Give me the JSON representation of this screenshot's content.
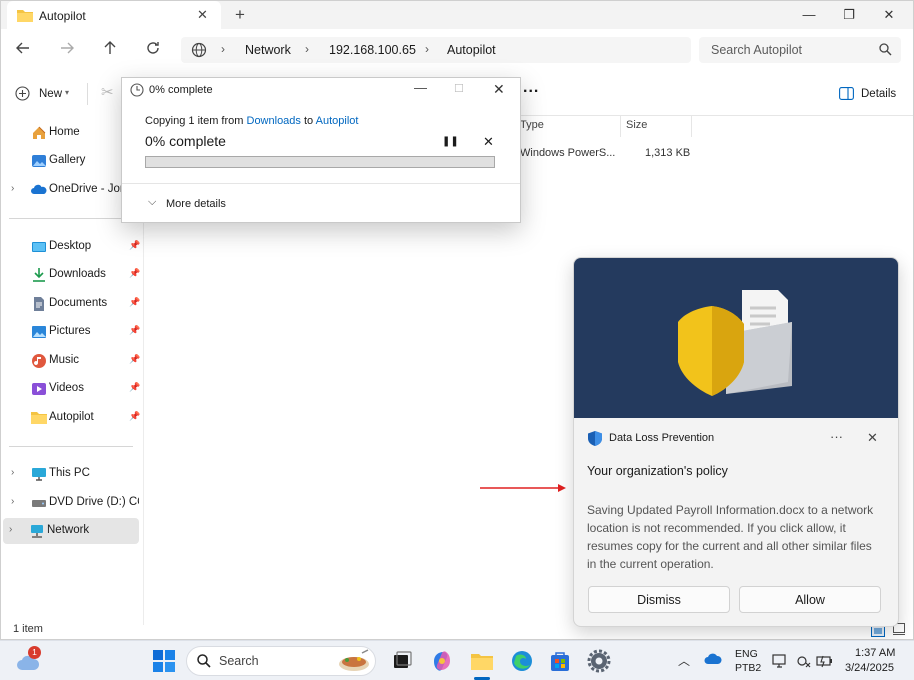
{
  "tab": {
    "title": "Autopilot"
  },
  "breadcrumb": [
    "Network",
    "192.168.100.65",
    "Autopilot"
  ],
  "search": {
    "placeholder": "Search Autopilot"
  },
  "toolbar": {
    "new_label": "New",
    "more": "...",
    "details_label": "Details"
  },
  "sidebar": {
    "top": [
      {
        "label": "Home",
        "icon": "home-icon"
      },
      {
        "label": "Gallery",
        "icon": "gallery-icon"
      },
      {
        "label": "OneDrive - Jorn",
        "icon": "onedrive-icon"
      }
    ],
    "quick": [
      {
        "label": "Desktop",
        "icon": "desktop-icon"
      },
      {
        "label": "Downloads",
        "icon": "downloads-icon"
      },
      {
        "label": "Documents",
        "icon": "documents-icon"
      },
      {
        "label": "Pictures",
        "icon": "pictures-icon"
      },
      {
        "label": "Music",
        "icon": "music-icon"
      },
      {
        "label": "Videos",
        "icon": "videos-icon"
      },
      {
        "label": "Autopilot",
        "icon": "folder-icon"
      }
    ],
    "bottom": [
      {
        "label": "This PC",
        "icon": "pc-icon"
      },
      {
        "label": "DVD Drive (D:) CCC",
        "icon": "dvd-icon"
      },
      {
        "label": "Network",
        "icon": "network-icon"
      }
    ]
  },
  "columns": {
    "type": "Type",
    "size": "Size"
  },
  "file_row": {
    "type": "Windows PowerS...",
    "size": "1,313 KB"
  },
  "status": {
    "count": "1 item"
  },
  "copy_dialog": {
    "title": "0% complete",
    "line_prefix": "Copying 1 item from",
    "from": "Downloads",
    "to_word": "to",
    "to": "Autopilot",
    "progress_text": "0% complete",
    "progress_percent": 0,
    "more_details": "More details"
  },
  "dlp": {
    "app_name": "Data Loss Prevention",
    "more": "···",
    "heading": "Your organization's policy",
    "body": "Saving Updated Payroll Information.docx to a network location is not recommended. If you click allow, it resumes copy for the current and all other similar files in the current operation.",
    "dismiss": "Dismiss",
    "allow": "Allow"
  },
  "taskbar": {
    "search_label": "Search",
    "weather_badge": "1",
    "lang": "ENG",
    "layout": "PTB2",
    "time": "1:37 AM",
    "date": "3/24/2025"
  },
  "colors": {
    "accent": "#0067c0",
    "dlp_hero": "#243a5e",
    "shield": "#f2c31b"
  }
}
